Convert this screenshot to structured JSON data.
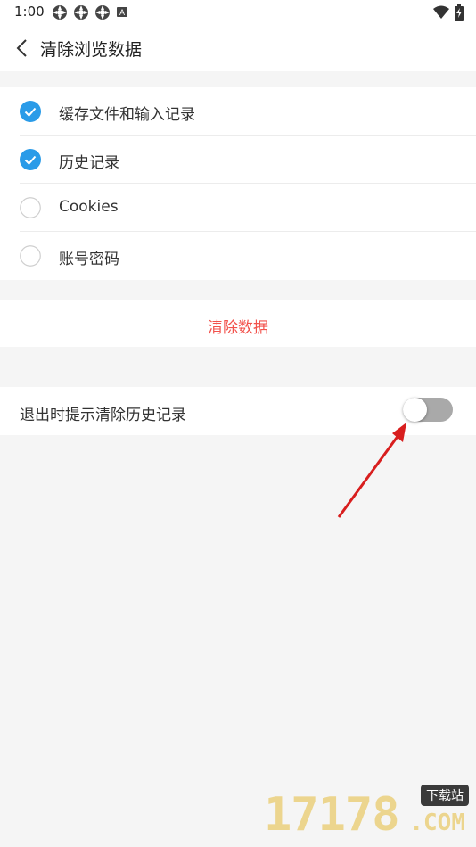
{
  "status_bar": {
    "time": "1:00",
    "left_icons": [
      "app-notification-icon",
      "app-notification-icon",
      "app-notification-icon",
      "keyboard-a-icon"
    ],
    "right_icons": [
      "wifi-icon",
      "battery-charging-icon"
    ]
  },
  "app_bar": {
    "back_icon": "chevron-left-icon",
    "title": "清除浏览数据"
  },
  "options": [
    {
      "label": "缓存文件和输入记录",
      "checked": true
    },
    {
      "label": "历史记录",
      "checked": true
    },
    {
      "label": "Cookies",
      "checked": false
    },
    {
      "label": "账号密码",
      "checked": false
    }
  ],
  "clear_button": {
    "label": "清除数据"
  },
  "exit_prompt": {
    "label": "退出时提示清除历史记录",
    "enabled": false
  },
  "colors": {
    "accent_blue": "#2a9be8",
    "clear_red": "#f2524c",
    "toggle_off": "#a9a9a9",
    "annotation_arrow": "#d81e1e",
    "background": "#f5f5f5"
  },
  "watermark": {
    "number": "17178",
    "badge": "下载站",
    "suffix": ".COM"
  }
}
